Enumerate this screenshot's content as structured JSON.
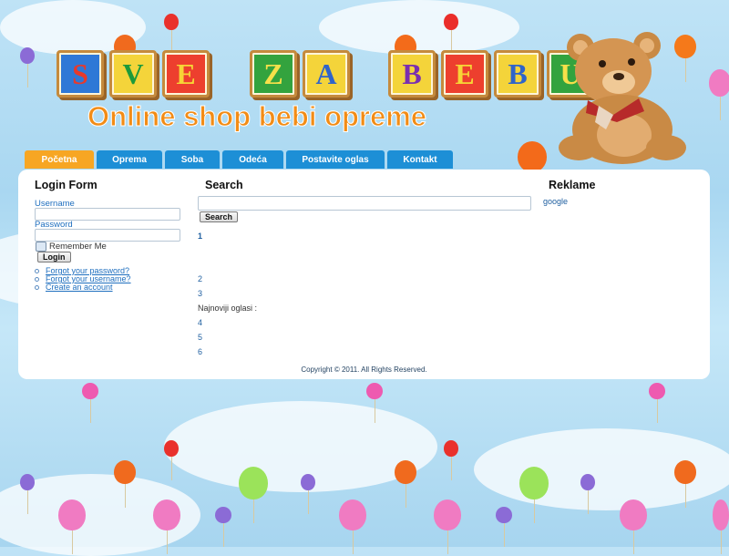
{
  "header": {
    "logo_letters": [
      "S",
      "V",
      "E",
      "Z",
      "A",
      "B",
      "E",
      "B",
      "U"
    ],
    "tagline": "Online shop bebi opreme"
  },
  "nav": {
    "items": [
      "Početna",
      "Oprema",
      "Soba",
      "Odeća",
      "Postavite oglas",
      "Kontakt"
    ],
    "active": "Početna"
  },
  "login": {
    "title": "Login Form",
    "username_label": "Username",
    "username_value": "",
    "password_label": "Password",
    "password_value": "",
    "remember_label": "Remember Me",
    "login_button": "Login",
    "links": [
      "Forgot your password?",
      "Forgot your username?",
      "Create an account"
    ]
  },
  "search": {
    "title": "Search",
    "input_value": "",
    "button": "Search"
  },
  "main": {
    "item_1": "1",
    "item_2": "2",
    "item_3": "3",
    "latest_ads_label": "Najnoviji oglasi :",
    "item_4": "4",
    "item_5": "5",
    "item_6": "6"
  },
  "ads": {
    "title": "Reklame",
    "text": "google"
  },
  "footer": {
    "copyright": "Copyright © 2011. All Rights Reserved."
  },
  "colors": {
    "nav_blue": "#1d8fd6",
    "nav_active": "#f7a623",
    "tagline_orange": "#f28c16",
    "link_blue": "#1f6fbf"
  }
}
